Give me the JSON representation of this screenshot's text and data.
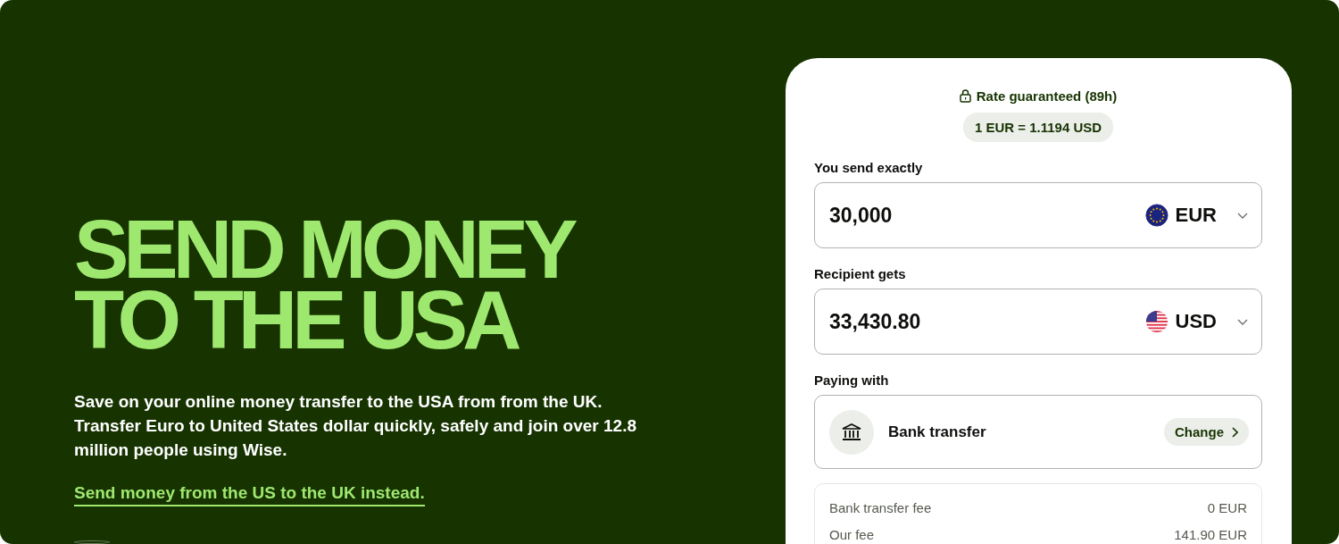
{
  "hero": {
    "headline": [
      "SEND MONEY",
      "TO THE USA"
    ],
    "description": "Save on your online money transfer to the USA from from the UK. Transfer Euro to United States dollar quickly, safely and join over 12.8 million people using Wise.",
    "link": "Send money from the US to the UK instead."
  },
  "converter": {
    "rate_guarantee": "Rate guaranteed (89h)",
    "rate": "1 EUR = 1.1194 USD",
    "amounts": [
      {
        "label": "You send exactly",
        "value": "30,000",
        "currency": "EUR",
        "kind": "eu"
      },
      {
        "label": "Recipient gets",
        "value": "33,430.80",
        "currency": "USD",
        "kind": "us"
      }
    ],
    "paying_with": {
      "label": "Paying with",
      "method": "Bank transfer",
      "action": "Change"
    },
    "fees": [
      {
        "name": "Bank transfer fee",
        "amount": "0 EUR"
      },
      {
        "name": "Our fee",
        "amount": "141.90 EUR"
      }
    ]
  }
}
